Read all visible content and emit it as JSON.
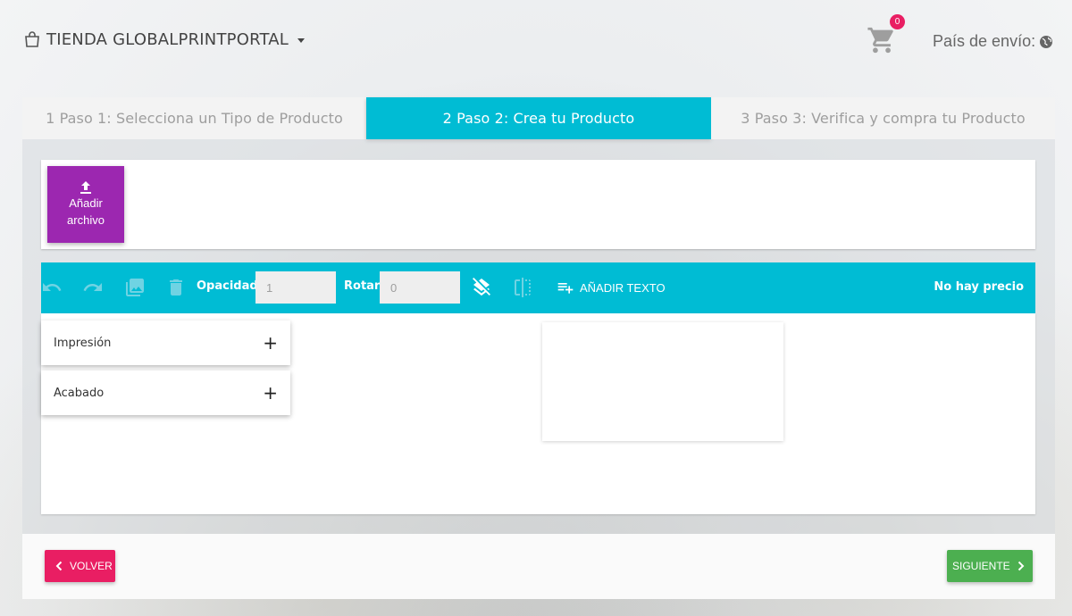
{
  "header": {
    "store_title": "TIENDA GLOBALPRINTPORTAL",
    "cart_count": "0",
    "country_label": "País de envío:"
  },
  "steps": [
    {
      "label": "1 Paso 1: Selecciona un Tipo de Producto"
    },
    {
      "label": "2 Paso 2: Crea tu Producto"
    },
    {
      "label": "3 Paso 3: Verifica y compra tu Producto"
    }
  ],
  "upload": {
    "label": "Añadir archivo"
  },
  "toolbar": {
    "opacity_label": "Opacidad",
    "opacity_value": "1",
    "rotate_label": "Rotar",
    "rotate_value": "0",
    "add_text_label": "AÑADIR TEXTO",
    "price_label": "No hay precio"
  },
  "options": [
    {
      "label": "Impresión"
    },
    {
      "label": "Acabado"
    }
  ],
  "footer": {
    "back_label": "VOLVER",
    "next_label": "SIGUIENTE"
  },
  "colors": {
    "accent": "#00bcd4",
    "upload_button": "#9c27b0",
    "back_button": "#e91e63",
    "next_button": "#4caf50",
    "badge": "#e91e63"
  }
}
